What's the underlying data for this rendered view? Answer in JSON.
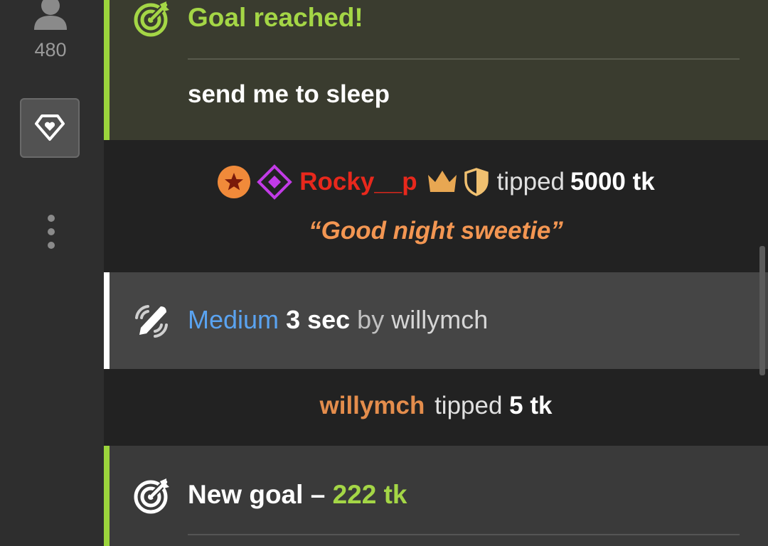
{
  "sidebar": {
    "viewer_icon": "user-icon",
    "viewer_count": "480",
    "diamond_icon": "diamond-heart-icon",
    "more_icon": "vertical-dots-icon"
  },
  "goal_reached": {
    "icon": "target-arrow-icon",
    "title": "Goal reached!",
    "description": "send me to sleep"
  },
  "tip_rocky": {
    "badges": [
      "star-rank-icon",
      "diamond-level-icon"
    ],
    "username": "Rocky__p",
    "status_icons": [
      "crown-icon",
      "shield-icon"
    ],
    "action": "tipped",
    "amount": "5000 tk",
    "message": "“Good night sweetie”"
  },
  "vibe": {
    "icon": "vibration-icon",
    "level": "Medium",
    "duration": "3 sec",
    "by": "by",
    "username": "willymch"
  },
  "tip_willy": {
    "username": "willymch",
    "action": "tipped",
    "amount": "5 tk"
  },
  "new_goal": {
    "icon": "target-arrow-icon",
    "label": "New goal –",
    "amount": "222 tk"
  },
  "colors": {
    "goal_green": "#a4d646",
    "rocky_red": "#e8281c",
    "message_orange": "#f39652",
    "vibe_blue": "#5aa3f0",
    "willy_orange": "#e48d4c"
  }
}
